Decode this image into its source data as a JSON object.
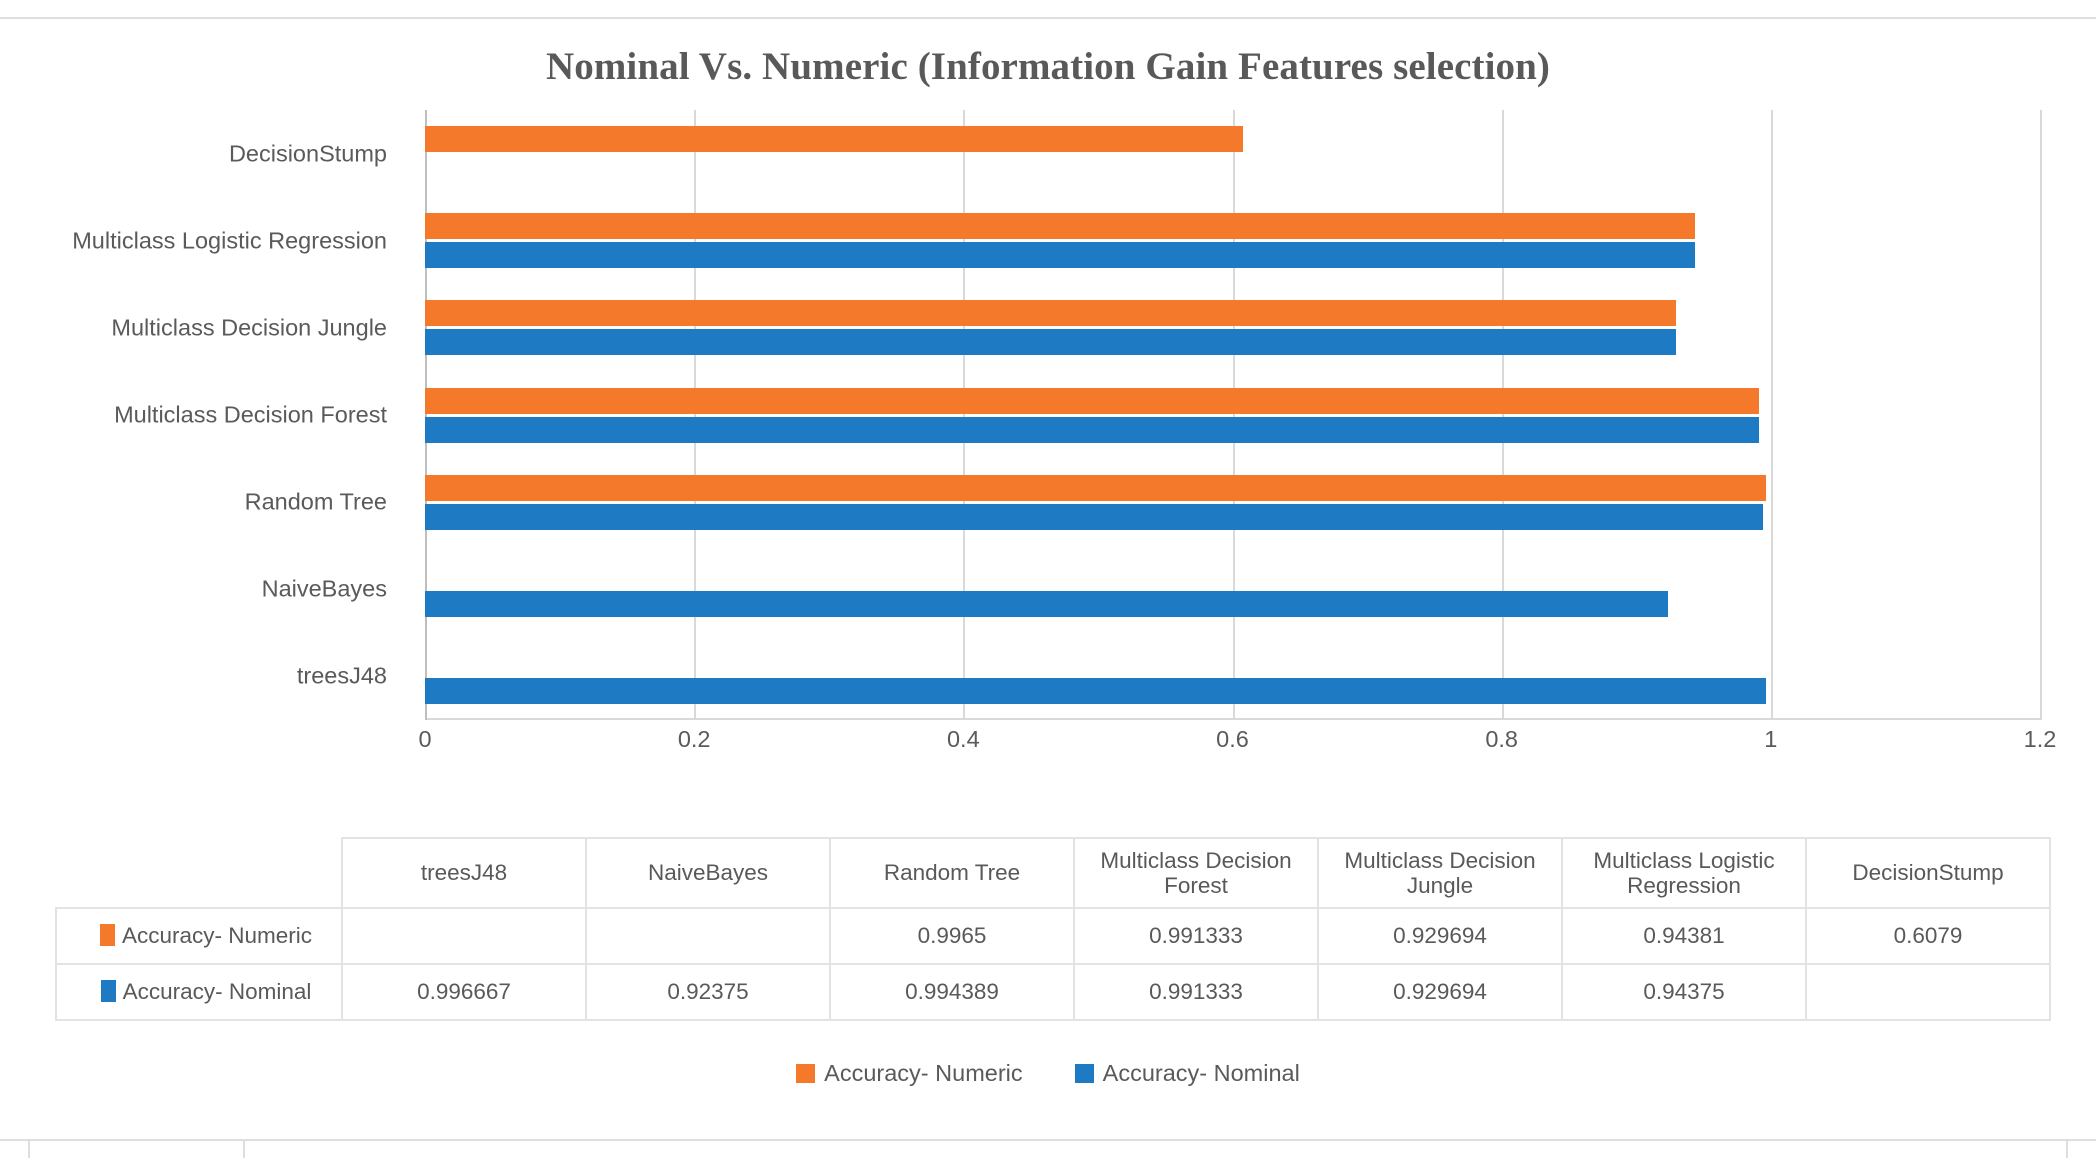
{
  "chart_data": {
    "type": "bar",
    "orientation": "horizontal",
    "title": "Nominal Vs. Numeric (Information Gain Features selection)",
    "xlabel": "",
    "ylabel": "",
    "xlim": [
      0,
      1.2
    ],
    "xticks": [
      "0",
      "0.2",
      "0.4",
      "0.6",
      "0.8",
      "1",
      "1.2"
    ],
    "xtick_values": [
      0,
      0.2,
      0.4,
      0.6,
      0.8,
      1,
      1.2
    ],
    "grid": true,
    "legend_position": "bottom",
    "categories": [
      "treesJ48",
      "NaiveBayes",
      "Random Tree",
      "Multiclass Decision Forest",
      "Multiclass Decision Jungle",
      "Multiclass Logistic Regression",
      "DecisionStump"
    ],
    "categories_axis_order": [
      "DecisionStump",
      "Multiclass Logistic Regression",
      "Multiclass Decision Jungle",
      "Multiclass Decision Forest",
      "Random Tree",
      "NaiveBayes",
      "treesJ48"
    ],
    "series": [
      {
        "name": "Accuracy- Numeric",
        "color": "#F4792B",
        "values": [
          null,
          null,
          0.9965,
          0.991333,
          0.929694,
          0.94381,
          0.6079
        ],
        "labels": [
          "",
          "",
          "0.9965",
          "0.991333",
          "0.929694",
          "0.94381",
          "0.6079"
        ]
      },
      {
        "name": "Accuracy-  Nominal",
        "color": "#1F7AC4",
        "values": [
          0.996667,
          0.92375,
          0.994389,
          0.991333,
          0.929694,
          0.94375,
          null
        ],
        "labels": [
          "0.996667",
          "0.92375",
          "0.994389",
          "0.991333",
          "0.929694",
          "0.94375",
          ""
        ]
      }
    ]
  },
  "table": {
    "header_corner": "",
    "columns": [
      "treesJ48",
      "NaiveBayes",
      "Random Tree",
      "Multiclass Decision Forest",
      "Multiclass Decision Jungle",
      "Multiclass Logistic Regression",
      "DecisionStump"
    ],
    "rows": [
      {
        "label": "Accuracy- Numeric",
        "swatch": "numeric",
        "cells": [
          "",
          "",
          "0.9965",
          "0.991333",
          "0.929694",
          "0.94381",
          "0.6079"
        ]
      },
      {
        "label": "Accuracy-  Nominal",
        "swatch": "nominal",
        "cells": [
          "0.996667",
          "0.92375",
          "0.994389",
          "0.991333",
          "0.929694",
          "0.94375",
          ""
        ]
      }
    ]
  },
  "legend": {
    "items": [
      {
        "label": "Accuracy- Numeric",
        "color": "#F4792B"
      },
      {
        "label": "Accuracy-  Nominal",
        "color": "#1F7AC4"
      }
    ]
  },
  "colors": {
    "numeric": "#F4792B",
    "nominal": "#1F7AC4",
    "text": "#595959",
    "gridline": "#D9D9D9"
  }
}
